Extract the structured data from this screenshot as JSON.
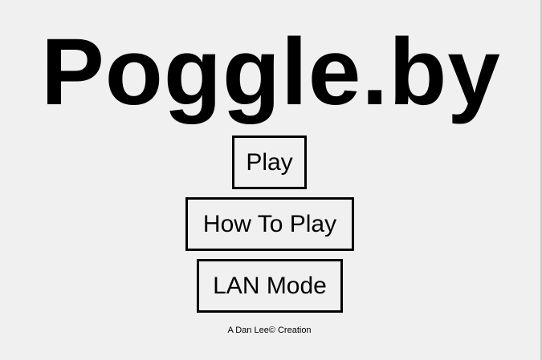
{
  "title": "Poggle.by",
  "menu": {
    "play_label": "Play",
    "how_to_play_label": "How To Play",
    "lan_mode_label": "LAN Mode"
  },
  "credit": "A Dan Lee© Creation",
  "colors": {
    "background": "#f0f0f0",
    "text": "#000000",
    "border": "#000000"
  }
}
